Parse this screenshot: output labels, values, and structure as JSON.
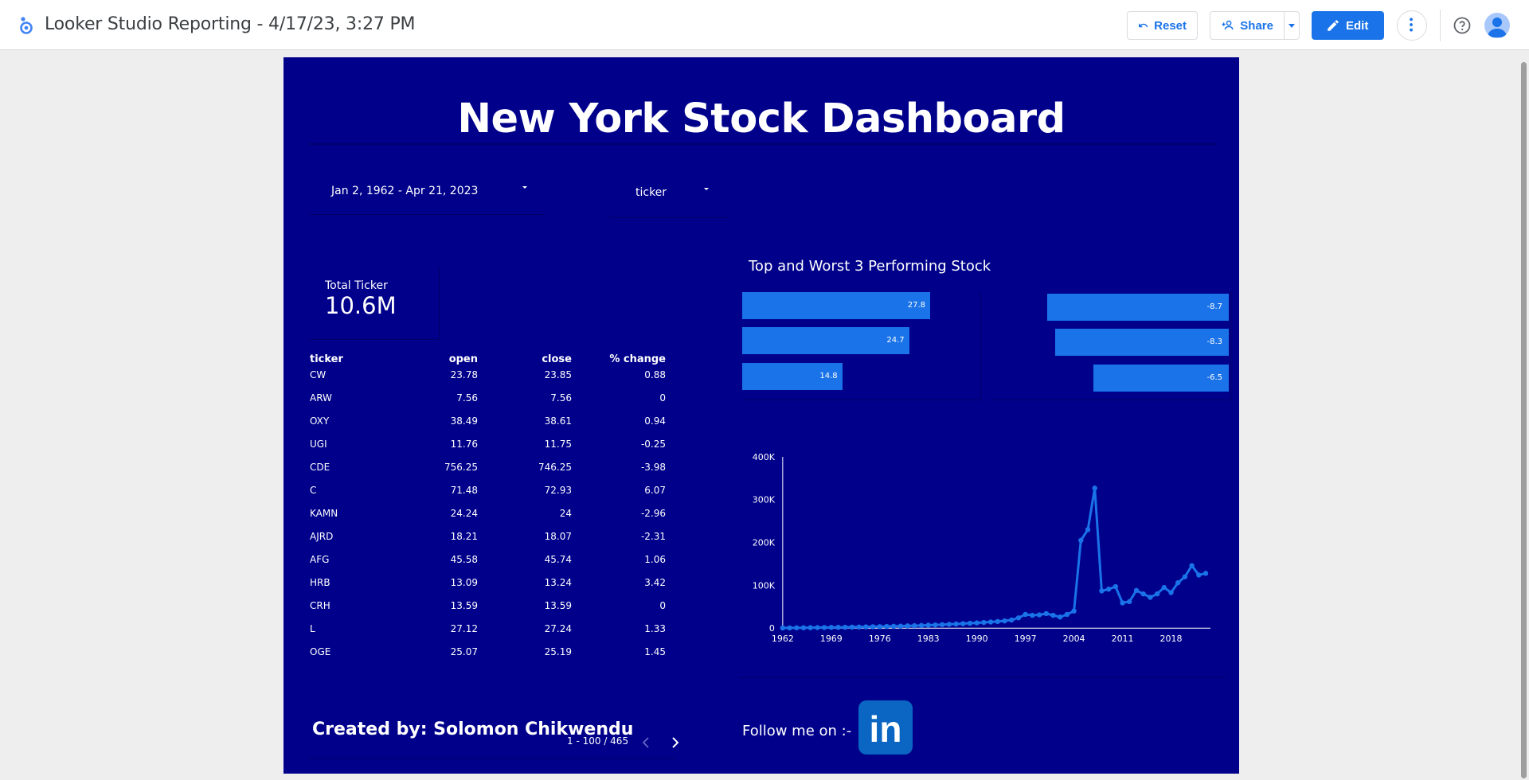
{
  "app": {
    "title": "Looker Studio Reporting - 4/17/23, 3:27 PM",
    "toolbar": {
      "reset_label": "Reset",
      "share_label": "Share",
      "edit_label": "Edit"
    },
    "icons": [
      "looker-studio-logo-icon",
      "undo-icon",
      "person-add-icon",
      "caret-down-icon",
      "pencil-icon",
      "more-vert-icon",
      "help-icon",
      "avatar-icon"
    ],
    "accent_color": "#1a73e8"
  },
  "report": {
    "background_color": "#00008b",
    "title": "New York Stock Dashboard",
    "date_range": "Jan 2, 1962 - Apr 21, 2023",
    "ticker_filter": "ticker",
    "scorecard": {
      "label": "Total Ticker",
      "value": "10.6M"
    },
    "table": {
      "columns": [
        "ticker",
        "open",
        "close",
        "% change"
      ],
      "rows": [
        [
          "CW",
          "23.78",
          "23.85",
          "0.88"
        ],
        [
          "ARW",
          "7.56",
          "7.56",
          "0"
        ],
        [
          "OXY",
          "38.49",
          "38.61",
          "0.94"
        ],
        [
          "UGI",
          "11.76",
          "11.75",
          "-0.25"
        ],
        [
          "CDE",
          "756.25",
          "746.25",
          "-3.98"
        ],
        [
          "C",
          "71.48",
          "72.93",
          "6.07"
        ],
        [
          "KAMN",
          "24.24",
          "24",
          "-2.96"
        ],
        [
          "AJRD",
          "18.21",
          "18.07",
          "-2.31"
        ],
        [
          "AFG",
          "45.58",
          "45.74",
          "1.06"
        ],
        [
          "HRB",
          "13.09",
          "13.24",
          "3.42"
        ],
        [
          "CRH",
          "13.59",
          "13.59",
          "0"
        ],
        [
          "L",
          "27.12",
          "27.24",
          "1.33"
        ],
        [
          "OGE",
          "25.07",
          "25.19",
          "1.45"
        ]
      ],
      "pagination": "1 - 100 / 465"
    },
    "performance": {
      "title": "Top and Worst 3 Performing Stock",
      "top": [
        "27.8",
        "24.7",
        "14.8"
      ],
      "worst": [
        "-8.7",
        "-8.3",
        "-6.5"
      ]
    },
    "footer": {
      "created_by": "Created by: Solomon Chikwendu",
      "follow": "Follow me on :-",
      "linkedin_text": "in"
    }
  },
  "chart_data": [
    {
      "type": "bar",
      "name": "top-performing",
      "orientation": "horizontal",
      "values": [
        27.8,
        24.7,
        14.8
      ]
    },
    {
      "type": "bar",
      "name": "worst-performing",
      "orientation": "horizontal",
      "values": [
        -8.7,
        -8.3,
        -6.5
      ]
    },
    {
      "type": "line",
      "x_ticks": [
        "1962",
        "1969",
        "1976",
        "1983",
        "1990",
        "1997",
        "2004",
        "2011",
        "2018"
      ],
      "y_ticks": [
        "0",
        "100K",
        "200K",
        "300K",
        "400K"
      ],
      "ylim": [
        0,
        400000
      ],
      "xlim": [
        1962,
        2023
      ],
      "x": [
        1962,
        1963,
        1964,
        1965,
        1966,
        1967,
        1968,
        1969,
        1970,
        1971,
        1972,
        1973,
        1974,
        1975,
        1976,
        1977,
        1978,
        1979,
        1980,
        1981,
        1982,
        1983,
        1984,
        1985,
        1986,
        1987,
        1988,
        1989,
        1990,
        1991,
        1992,
        1993,
        1994,
        1995,
        1996,
        1997,
        1998,
        1999,
        2000,
        2001,
        2002,
        2003,
        2004,
        2005,
        2006,
        2007,
        2008,
        2009,
        2010,
        2011,
        2012,
        2013,
        2014,
        2015,
        2016,
        2017,
        2018,
        2019,
        2020,
        2021,
        2022,
        2023
      ],
      "values": [
        500,
        600,
        800,
        900,
        1100,
        1300,
        1500,
        1700,
        1900,
        2100,
        2400,
        2700,
        3000,
        3300,
        3600,
        4000,
        4400,
        4800,
        5300,
        5800,
        6300,
        6900,
        7500,
        8200,
        8900,
        9700,
        10500,
        11400,
        12300,
        13300,
        14400,
        15600,
        17000,
        19000,
        24000,
        32000,
        30000,
        31000,
        34000,
        30000,
        26000,
        32000,
        40000,
        205000,
        230000,
        327000,
        87000,
        91000,
        97000,
        59000,
        62000,
        88000,
        80000,
        72000,
        80000,
        95000,
        83000,
        106000,
        120000,
        146000,
        124000,
        128000
      ]
    }
  ]
}
